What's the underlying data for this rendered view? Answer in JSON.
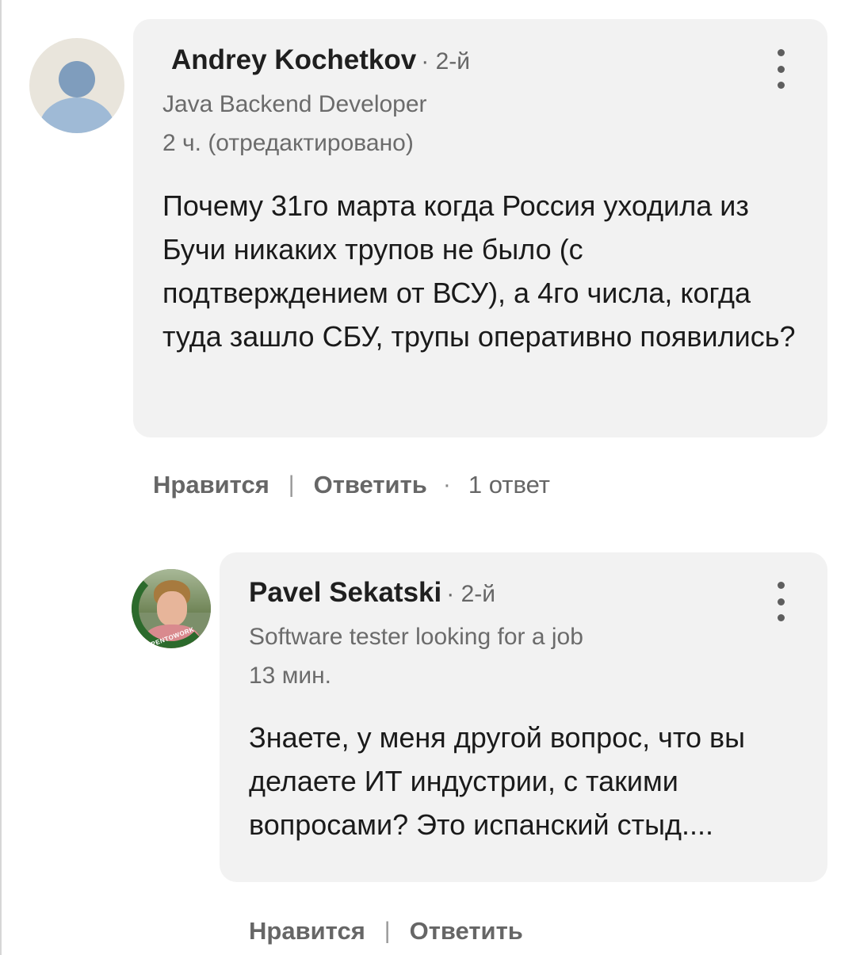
{
  "comment": {
    "author": "Andrey Kochetkov",
    "degree": "· 2-й",
    "headline": "Java Backend Developer",
    "time": "2 ч. (отредактировано)",
    "text": "Почему 31го марта когда Россия уходила из Бучи никаких трупов не было (с подтверждением от ВСУ), а 4го числа, когда туда зашло СБУ, трупы оперативно появились?",
    "like_label": "Нравится",
    "reply_label": "Ответить",
    "replies_count": "1 ответ"
  },
  "reply": {
    "author": "Pavel Sekatski",
    "degree": "· 2-й",
    "headline": "Software tester looking for a job",
    "time": "13 мин.",
    "text": "Знаете, у меня другой вопрос, что вы делаете ИТ индустрии, с такими вопросами? Это испанский стыд....",
    "avatar_badge": "#OPENTOWORK",
    "like_label": "Нравится",
    "reply_label": "Ответить"
  },
  "separator": "|",
  "colors": {
    "bubble": "#f2f2f2",
    "open_to_work_ring": "#2c6a2c"
  },
  "icons": {
    "more": "vertical-ellipsis",
    "generic_avatar": "person-silhouette"
  }
}
